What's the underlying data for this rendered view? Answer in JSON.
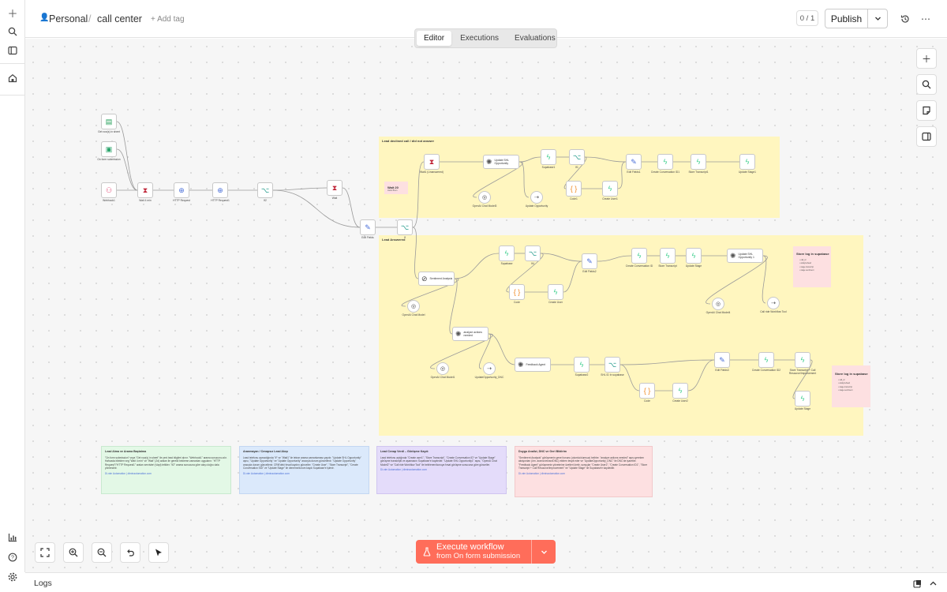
{
  "breadcrumb": {
    "project": "Personal",
    "separator": "/",
    "workflow": "call center",
    "add_tag": "+ Add tag"
  },
  "header": {
    "counter": "0 / 1",
    "publish": "Publish"
  },
  "tabs": [
    "Editor",
    "Executions",
    "Evaluations"
  ],
  "execute": {
    "label": "Execute workflow",
    "sub": "from On form submission"
  },
  "logs": "Logs",
  "colors": {
    "accent": "#ff6d5a",
    "yellow": "#fff6bf",
    "green": "#e3f8e6",
    "blue": "#dbe9fb",
    "purple": "#e4dcfa",
    "pink": "#fde0e1",
    "edge": "#9a9a9a"
  },
  "sections": {
    "declined": "Lead declined call / did not answer",
    "answered": "Lead Answered",
    "wait20": "Wait 20",
    "wait20_sub": "Hello Blum",
    "store1": "Store log in supabase",
    "store2": "Store log in supabase"
  },
  "notes": [
    {
      "title": "Lead Alma ve Arama Başlatma",
      "body": "\"On form submission\" veya \"Get row(s) in sheet\" ile yeni lead bilgileri alınır. \"Webhook1\" arama sonucunu alır. Hafızada bilekten veg \"Wait 4 min\" ve \"Wait\" (2d) araları ile gerekli bekleme zamanları uygulanır. \"HTTP Request\"/\"HTTP Request1\" araları servisleri (Vapi) tetikler. \"If2\" arama sonucuna göre akışı doğru dala yönlendirir.",
      "link": "Di-nim Automation | diminautomation.com"
    },
    {
      "title": "Aranmayan / Cevapsız Lead Akışı",
      "body": "Lead telefonu açmadığında \"If\" ve \"Wait1\" ile tekrar arama zamanlaması yapılır. \"Update SHL Opportunity\" aşısı, \"Update Opportunity\" ve \"Update Opportunity\" aracıyla durum güncellenir. \"Update Opportunity\" aracıyla durum güncellenir. CRM'deki fırsat kaydını günceller. \"Create User\", \"Store Transcript\", \"Create Conversation SID\" ve \"Update Stage\" ile deneme/durum kaydı Supabase'e işlenir.",
      "link": "Di-nim Automation | diminautomation.com"
    },
    {
      "title": "Lead Cevap Verdi – Görüşme Kaydı",
      "body": "Lead telefonu açtığında \"Create user1\", \"Store Transcript\", \"Create Conversation ID\" ve \"Update Stage\" görüşme transkripti ve aşamasını Supabase'e kaydeder. \"Update SHL Opportunity1\" aşısı, \"OpenAI Chat Model2\" ve \"Call ride Workflow Tool\" ile belirlenen/konuya fırsat görüşme sonucuna göre günceller.",
      "link": "Di-nim Automation | diminautomation.com"
    },
    {
      "title": "Duygu Analizi, DNC ve Geri Bildirim",
      "body": "\"Sentiment Analysis\" görüşmenin genel tonunu (olumlu/olumsuz) belirler. \"analyze actions needed\" aşısı gereken aksiyonları (örn. arama tekrarı/DNC) ektiren tespit eder ve \"UpdateOpportunity_DNC\" ile DNC'de işaretler. \"Feedback Agent\" görüşmenin yönetmine özetleri üretir, sonuçlar \"Create User2\", \"Create Conversation ID1\", \"Store Transcript + Call Resource/Improvement\" ve \"Update Stage\" ile Supabase'e kaydedilir.",
      "link": "Di-nim Automation | diminautomation.com"
    }
  ],
  "nodes": [
    {
      "id": "n1",
      "label": "Get row(s) in sheet",
      "sub": "",
      "icon": "▤",
      "color": "#1f9d55"
    },
    {
      "id": "n2",
      "label": "On form submission",
      "sub": "",
      "icon": "▣",
      "color": "#29a36a"
    },
    {
      "id": "n3",
      "label": "Webhook1",
      "sub": "",
      "icon": "⚇",
      "color": "#e2507a"
    },
    {
      "id": "n4",
      "label": "Wait 4 min",
      "sub": "",
      "icon": "⧗",
      "color": "#c0283b"
    },
    {
      "id": "n5",
      "label": "HTTP Request",
      "sub": "",
      "icon": "⊕",
      "color": "#4a6fd8"
    },
    {
      "id": "n6",
      "label": "HTTP Request1",
      "sub": "",
      "icon": "⊕",
      "color": "#4a6fd8"
    },
    {
      "id": "n7",
      "label": "If2",
      "sub": "",
      "icon": "⌥",
      "color": "#2a9d8f"
    },
    {
      "id": "n8",
      "label": "Wait",
      "sub": "",
      "icon": "⧗",
      "color": "#c0283b"
    },
    {
      "id": "n9",
      "label": "Edit Fields",
      "sub": "",
      "icon": "✎",
      "color": "#4a6fd8"
    },
    {
      "id": "n10",
      "label": "If",
      "sub": "",
      "icon": "⌥",
      "color": "#2a9d8f"
    },
    {
      "id": "n11",
      "label": "Wait1 (Unanswered)",
      "sub": "",
      "icon": "⧗",
      "color": "#c0283b"
    },
    {
      "id": "n12",
      "label": "Update SHL Opportunity",
      "sub": "",
      "icon": "✺",
      "color": "#555"
    },
    {
      "id": "n13",
      "label": "Supabase1",
      "sub": "",
      "icon": "ϟ",
      "color": "#3ecf8e"
    },
    {
      "id": "n14",
      "label": "If1",
      "sub": "",
      "icon": "⌥",
      "color": "#2a9d8f"
    },
    {
      "id": "n15",
      "label": "Code1",
      "sub": "",
      "icon": "{ }",
      "color": "#f08c28"
    },
    {
      "id": "n16",
      "label": "Create User1",
      "sub": "",
      "icon": "ϟ",
      "color": "#3ecf8e"
    },
    {
      "id": "n17",
      "label": "Edit Fields1",
      "sub": "",
      "icon": "✎",
      "color": "#4a6fd8"
    },
    {
      "id": "n18",
      "label": "Create Conversation ID1",
      "sub": "",
      "icon": "ϟ",
      "color": "#3ecf8e"
    },
    {
      "id": "n19",
      "label": "Store Transcript1",
      "sub": "",
      "icon": "ϟ",
      "color": "#3ecf8e"
    },
    {
      "id": "n20",
      "label": "Update Stage1",
      "sub": "",
      "icon": "ϟ",
      "color": "#3ecf8e"
    },
    {
      "id": "n21",
      "label": "OpenAI Chat Model3",
      "sub": "",
      "icon": "◎",
      "color": "#444"
    },
    {
      "id": "n22",
      "label": "Update Opportunity",
      "sub": "",
      "icon": "⇢",
      "color": "#444"
    },
    {
      "id": "n23",
      "label": "Sentiment Analysis",
      "sub": "",
      "icon": "⊘",
      "color": "#444"
    },
    {
      "id": "n24",
      "label": "Supabase",
      "sub": "",
      "icon": "ϟ",
      "color": "#3ecf8e"
    },
    {
      "id": "n25",
      "label": "If4",
      "sub": "",
      "icon": "⌥",
      "color": "#2a9d8f"
    },
    {
      "id": "n26",
      "label": "Code",
      "sub": "",
      "icon": "{ }",
      "color": "#f08c28"
    },
    {
      "id": "n27",
      "label": "Create User",
      "sub": "",
      "icon": "ϟ",
      "color": "#3ecf8e"
    },
    {
      "id": "n28",
      "label": "Edit Fields2",
      "sub": "",
      "icon": "✎",
      "color": "#4a6fd8"
    },
    {
      "id": "n29",
      "label": "Create Conversation ID",
      "sub": "",
      "icon": "ϟ",
      "color": "#3ecf8e"
    },
    {
      "id": "n30",
      "label": "Store Transcript",
      "sub": "",
      "icon": "ϟ",
      "color": "#3ecf8e"
    },
    {
      "id": "n31",
      "label": "Update Stage",
      "sub": "",
      "icon": "ϟ",
      "color": "#3ecf8e"
    },
    {
      "id": "n32",
      "label": "Update SHL Opportunity 1",
      "sub": "",
      "icon": "✺",
      "color": "#555"
    },
    {
      "id": "n33",
      "label": "OpenAI Chat Model4",
      "sub": "",
      "icon": "◎",
      "color": "#444"
    },
    {
      "id": "n34",
      "label": "Call ride Workflow Tool",
      "sub": "",
      "icon": "⇢",
      "color": "#444"
    },
    {
      "id": "n35",
      "label": "OpenAI Chat Model",
      "sub": "",
      "icon": "◎",
      "color": "#444"
    },
    {
      "id": "n36",
      "label": "analyze actions needed",
      "sub": "",
      "icon": "✺",
      "color": "#555"
    },
    {
      "id": "n37",
      "label": "OpenAI Chat Model1",
      "sub": "",
      "icon": "◎",
      "color": "#444"
    },
    {
      "id": "n38",
      "label": "UpdateOpportunity_DNC",
      "sub": "",
      "icon": "⇢",
      "color": "#444"
    },
    {
      "id": "n39",
      "label": "Feedback Agent",
      "sub": "",
      "icon": "✺",
      "color": "#555"
    },
    {
      "id": "n40",
      "label": "Supabase2",
      "sub": "",
      "icon": "ϟ",
      "color": "#3ecf8e"
    },
    {
      "id": "n41",
      "label": "SHL ID In supabase",
      "sub": "",
      "icon": "⌥",
      "color": "#2a9d8f"
    },
    {
      "id": "n42",
      "label": "Code",
      "sub": "",
      "icon": "{ }",
      "color": "#f08c28"
    },
    {
      "id": "n43",
      "label": "Create User2",
      "sub": "",
      "icon": "ϟ",
      "color": "#3ecf8e"
    },
    {
      "id": "n44",
      "label": "Edit Fields3",
      "sub": "",
      "icon": "✎",
      "color": "#4a6fd8"
    },
    {
      "id": "n45",
      "label": "Create Conversation ID2",
      "sub": "",
      "icon": "ϟ",
      "color": "#3ecf8e"
    },
    {
      "id": "n46",
      "label": "Store Transcript + Call Resource/Improvement",
      "sub": "",
      "icon": "ϟ",
      "color": "#3ecf8e"
    },
    {
      "id": "n47",
      "label": "Update Stage",
      "sub": "",
      "icon": "ϟ",
      "color": "#3ecf8e"
    }
  ]
}
